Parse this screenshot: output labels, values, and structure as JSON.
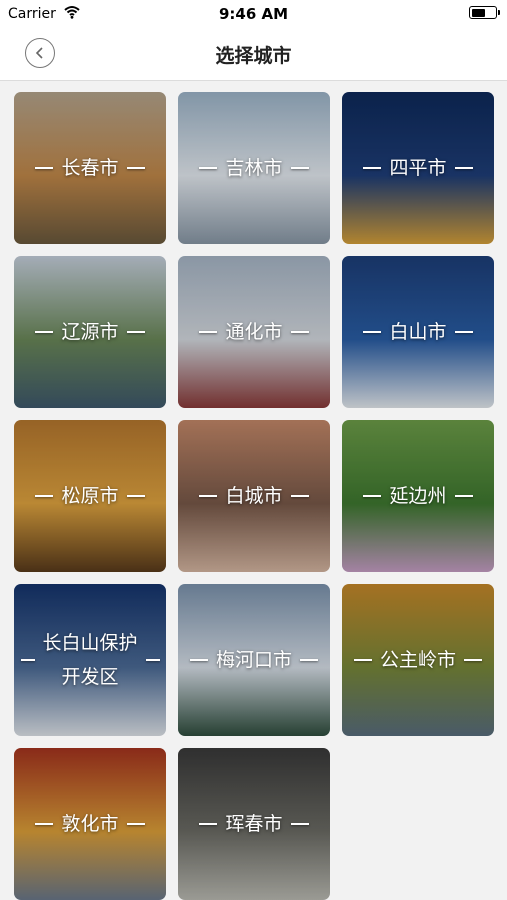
{
  "status_bar": {
    "carrier": "Carrier",
    "time": "9:46 AM",
    "battery_level": 0.6
  },
  "nav": {
    "title": "选择城市",
    "back_icon": "chevron-left-icon"
  },
  "cities": [
    {
      "name": "长春市",
      "key": "changchun",
      "colors": [
        "#b8a78f",
        "#c48a4a",
        "#6b5a3e"
      ]
    },
    {
      "name": "吉林市",
      "key": "jilin",
      "colors": [
        "#9fb7cc",
        "#e8eef4",
        "#8a99a8"
      ]
    },
    {
      "name": "四平市",
      "key": "siping",
      "colors": [
        "#0e2a5c",
        "#1f3f7a",
        "#d9a23a"
      ]
    },
    {
      "name": "辽源市",
      "key": "liaoyuan",
      "colors": [
        "#c9d3e0",
        "#6c8a5a",
        "#3f5a6e"
      ]
    },
    {
      "name": "通化市",
      "key": "tonghua",
      "colors": [
        "#a9b8c9",
        "#d8dde3",
        "#8b3a3a"
      ]
    },
    {
      "name": "白山市",
      "key": "baishan",
      "colors": [
        "#1d3f7a",
        "#2a5fa8",
        "#e9eef3"
      ]
    },
    {
      "name": "松原市",
      "key": "songyuan",
      "colors": [
        "#b8792f",
        "#e3a640",
        "#5a3b1c"
      ]
    },
    {
      "name": "白城市",
      "key": "baicheng",
      "colors": [
        "#c78a6a",
        "#7a5a4a",
        "#d9b9a4"
      ]
    },
    {
      "name": "延边州",
      "key": "yanbian",
      "colors": [
        "#6fa04a",
        "#3f7a30",
        "#c9a0c8"
      ]
    },
    {
      "name": "长白山保护开发区",
      "key": "changbaishan",
      "colors": [
        "#15356f",
        "#4d6d99",
        "#e3e8ee"
      ],
      "two_line": true
    },
    {
      "name": "梅河口市",
      "key": "meihekou",
      "colors": [
        "#7d95b0",
        "#dbe3ec",
        "#2f4e3e"
      ]
    },
    {
      "name": "公主岭市",
      "key": "gongzhuling",
      "colors": [
        "#c98a2a",
        "#7a8a3a",
        "#5a6f7f"
      ]
    },
    {
      "name": "敦化市",
      "key": "dunhua",
      "colors": [
        "#a8341f",
        "#e0a23a",
        "#6c7a8c"
      ]
    },
    {
      "name": "珲春市",
      "key": "hunchun",
      "colors": [
        "#3a3a3a",
        "#6d6d66",
        "#bdbdb5"
      ]
    }
  ]
}
